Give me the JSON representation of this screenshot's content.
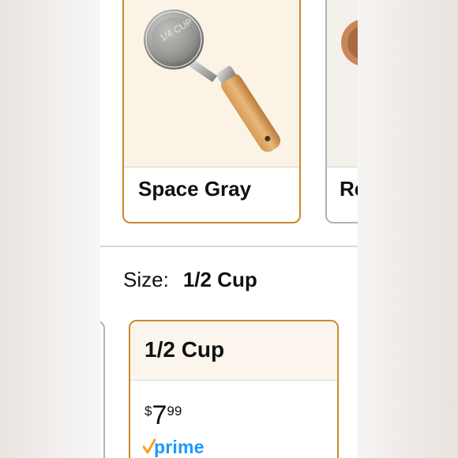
{
  "color_options": [
    {
      "label": "Space Gray",
      "selected": true
    },
    {
      "label": "Re",
      "selected": false
    }
  ],
  "size": {
    "label": "Size:",
    "selected_value": "1/2 Cup"
  },
  "size_options": [
    {
      "label": "1/2 Cup",
      "price": {
        "symbol": "$",
        "whole": "7",
        "fraction": "99"
      },
      "badge": "prime",
      "selected": true
    }
  ],
  "colors": {
    "selected_border": "#c9892a",
    "unselected_border": "#aeb4b4",
    "prime_blue": "#1a98ff",
    "prime_check": "#f7a21b"
  },
  "icons": [
    "measuring-cup-product-image",
    "prime-check-icon"
  ]
}
